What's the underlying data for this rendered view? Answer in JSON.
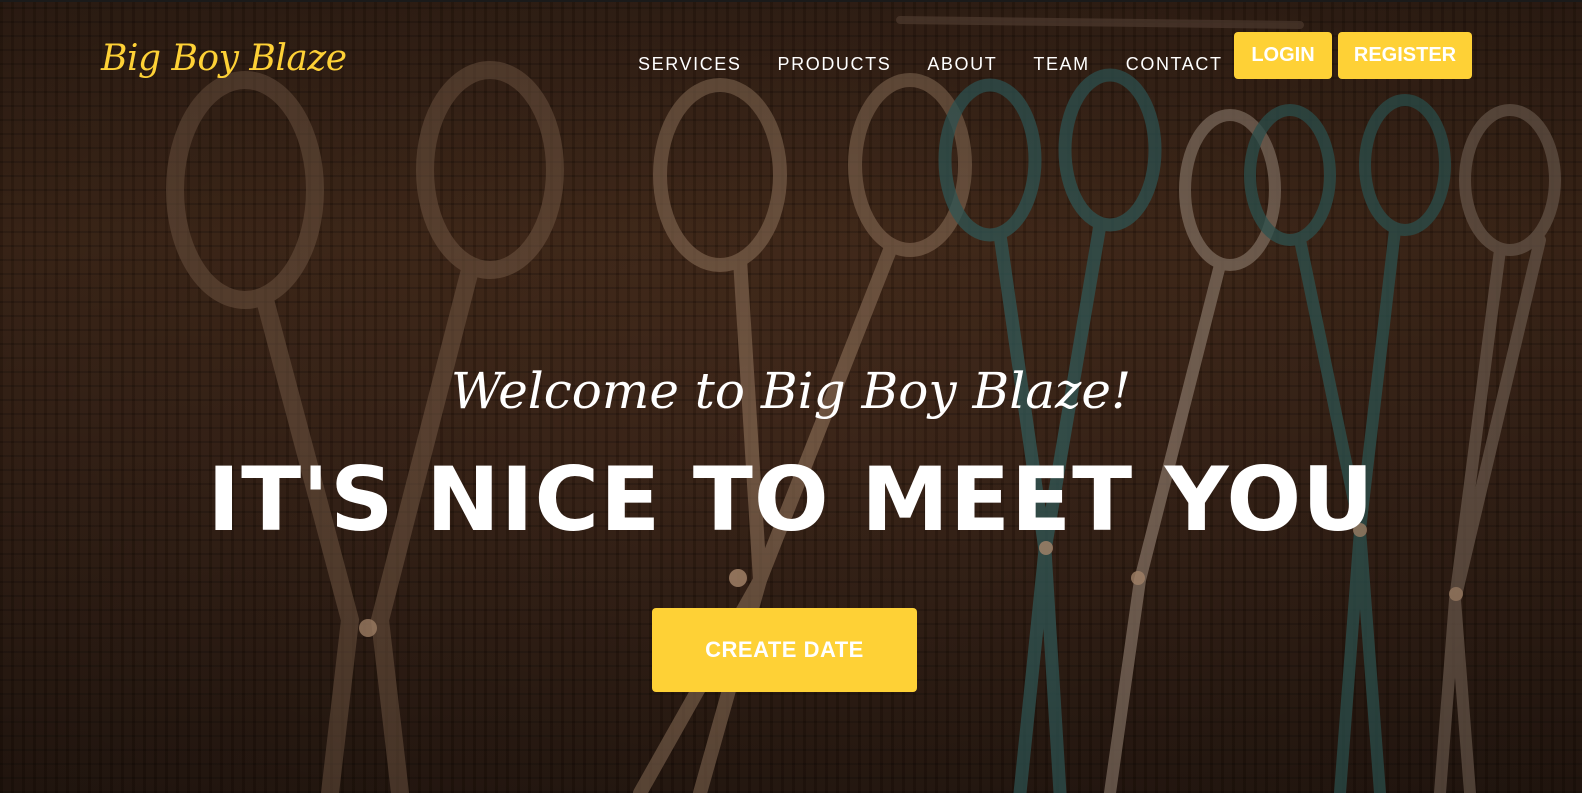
{
  "brand": {
    "name": "Big Boy Blaze"
  },
  "nav": {
    "items": [
      {
        "label": "SERVICES"
      },
      {
        "label": "PRODUCTS"
      },
      {
        "label": "ABOUT"
      },
      {
        "label": "TEAM"
      },
      {
        "label": "CONTACT"
      }
    ],
    "login_label": "LOGIN",
    "register_label": "REGISTER"
  },
  "hero": {
    "welcome": "Welcome to Big Boy Blaze!",
    "headline": "IT'S NICE TO MEET YOU",
    "cta_label": "CREATE DATE",
    "background_icon": "scissors-rack-photo"
  },
  "colors": {
    "accent": "#fed136",
    "text": "#ffffff",
    "background": "#3b2416"
  }
}
